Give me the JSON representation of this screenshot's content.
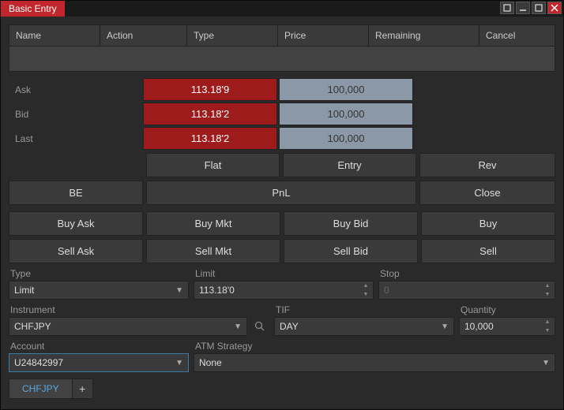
{
  "title": "Basic Entry",
  "columns": {
    "name": "Name",
    "action": "Action",
    "type": "Type",
    "price": "Price",
    "remaining": "Remaining",
    "cancel": "Cancel"
  },
  "quotes": {
    "ask": {
      "label": "Ask",
      "price": "113.18'9",
      "vol": "100,000"
    },
    "bid": {
      "label": "Bid",
      "price": "113.18'2",
      "vol": "100,000"
    },
    "last": {
      "label": "Last",
      "price": "113.18'2",
      "vol": "100,000"
    }
  },
  "buttons": {
    "flat": "Flat",
    "entry": "Entry",
    "rev": "Rev",
    "be": "BE",
    "pnl": "PnL",
    "close": "Close",
    "buyask": "Buy Ask",
    "buymkt": "Buy Mkt",
    "buybid": "Buy Bid",
    "buy": "Buy",
    "sellask": "Sell Ask",
    "sellmkt": "Sell Mkt",
    "sellbid": "Sell Bid",
    "sell": "Sell"
  },
  "form": {
    "type": {
      "label": "Type",
      "value": "Limit"
    },
    "limit": {
      "label": "Limit",
      "value": "113.18'0"
    },
    "stop": {
      "label": "Stop",
      "value": "0"
    },
    "instrument": {
      "label": "Instrument",
      "value": "CHFJPY"
    },
    "tif": {
      "label": "TIF",
      "value": "DAY"
    },
    "quantity": {
      "label": "Quantity",
      "value": "10,000"
    },
    "account": {
      "label": "Account",
      "value": "U24842997"
    },
    "atm": {
      "label": "ATM Strategy",
      "value": "None"
    }
  },
  "tab": "CHFJPY"
}
